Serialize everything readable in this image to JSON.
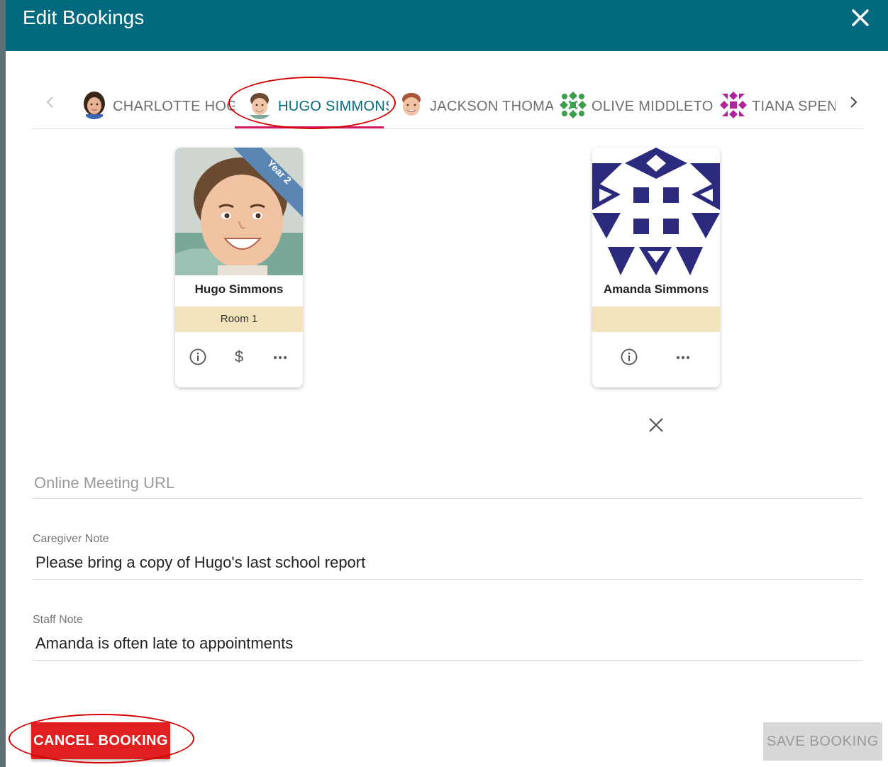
{
  "dialog": {
    "title": "Edit Bookings",
    "close_icon": "close-icon"
  },
  "tabs": [
    {
      "label": "CHARLOTTE HOGAN",
      "avatar": "child-photo",
      "active": false
    },
    {
      "label": "HUGO SIMMONS",
      "avatar": "child-photo",
      "active": true
    },
    {
      "label": "JACKSON THOMAS",
      "avatar": "child-photo",
      "active": false
    },
    {
      "label": "OLIVE MIDDLETON",
      "avatar": "green-identicon",
      "active": false
    },
    {
      "label": "TIANA SPENCER",
      "avatar": "magenta-identicon",
      "active": false
    }
  ],
  "cards": {
    "child": {
      "name": "Hugo Simmons",
      "ribbon": "Year 2",
      "room": "Room 1",
      "actions": [
        "info-icon",
        "dollar-icon",
        "more-icon"
      ]
    },
    "caregiver": {
      "name": "Amanda Simmons",
      "room": "",
      "actions": [
        "info-icon",
        "more-icon"
      ],
      "remove_icon": "close-icon"
    }
  },
  "fields": {
    "meeting_url": {
      "placeholder": "Online Meeting URL",
      "value": ""
    },
    "caregiver_note": {
      "label": "Caregiver Note",
      "value": "Please bring a copy of Hugo's last school report"
    },
    "staff_note": {
      "label": "Staff Note",
      "value": "Amanda is often late to appointments"
    }
  },
  "buttons": {
    "cancel": "CANCEL BOOKING",
    "save": "SAVE BOOKING"
  },
  "colors": {
    "header": "#02697e",
    "active_tab": "#02697e",
    "tab_underline": "#d81b60",
    "room_band": "#f2e3bc",
    "ribbon": "#5b86b3",
    "identicon_navy": "#2b2a7c",
    "cancel_button": "#e02020",
    "annotation_ring": "#d40000"
  }
}
